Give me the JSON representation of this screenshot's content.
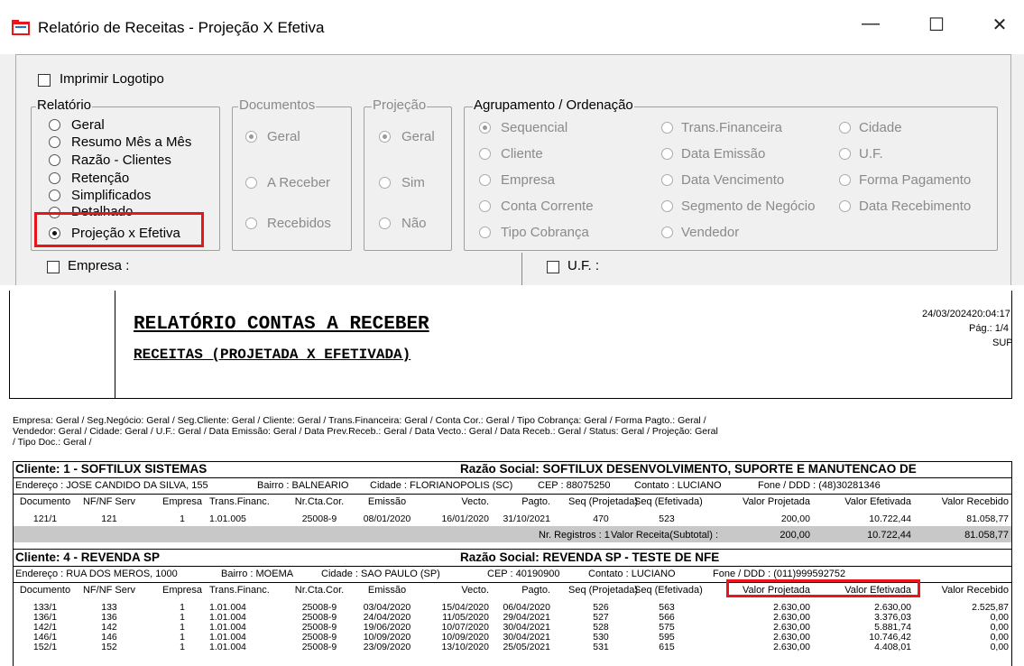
{
  "window": {
    "title": "Relatório de Receitas - Projeção X Efetiva",
    "minimize": "—",
    "maximize": "☐",
    "close": "✕"
  },
  "form": {
    "print_logo": "Imprimir Logotipo",
    "relatorio": {
      "legend": "Relatório",
      "options": [
        "Geral",
        "Resumo Mês a Mês",
        "Razão - Clientes",
        "Retenção",
        "Simplificados",
        "Detalhado",
        "Projeção x Efetiva"
      ],
      "selected": "Projeção x Efetiva"
    },
    "documentos": {
      "legend": "Documentos",
      "options": [
        "Geral",
        "A Receber",
        "Recebidos"
      ]
    },
    "projecao": {
      "legend": "Projeção",
      "options": [
        "Geral",
        "Sim",
        "Não"
      ]
    },
    "agrupamento": {
      "legend": "Agrupamento / Ordenação",
      "col1": [
        "Sequencial",
        "Cliente",
        "Empresa",
        "Conta Corrente",
        "Tipo Cobrança"
      ],
      "col2": [
        "Trans.Financeira",
        "Data Emissão",
        "Data Vencimento",
        "Segmento de Negócio",
        "Vendedor"
      ],
      "col3": [
        "Cidade",
        "U.F.",
        "Forma Pagamento",
        "Data Recebimento"
      ]
    },
    "empresa": "Empresa :",
    "uf": "U.F. :"
  },
  "report": {
    "title": "RELATÓRIO CONTAS A RECEBER",
    "subtitle": "RECEITAS (PROJETADA X EFETIVADA)",
    "date": "24/03/2024",
    "time": "20:04:17",
    "page": "Pág.: 1/4",
    "user": "SUP",
    "filters_line1": "Empresa: Geral   /   Seg.Negócio: Geral   /   Seg.Cliente: Geral   /   Cliente: Geral   / Trans.Financeira: Geral   /   Conta Cor.: Geral   /   Tipo Cobrança: Geral   /   Forma Pagto.: Geral   /",
    "filters_line2": "Vendedor: Geral   /   Cidade: Geral   /   U.F.: Geral   /   Data Emissão: Geral   /   Data Prev.Receb.: Geral   /   Data Vecto.: Geral   /   Data Receb.: Geral   /   Status: Geral   /   Projeção: Geral",
    "filters_line3": "/   Tipo Doc.: Geral   /",
    "columns": [
      "Documento",
      "NF/NF Serv",
      "Empresa",
      "Trans.Financ.",
      "Nr.Cta.Cor.",
      "Emissão",
      "Vecto.",
      "Pagto.",
      "Seq (Projetada)",
      "Seq (Efetivada)",
      "Valor Projetada",
      "Valor Efetivada",
      "Valor Recebido"
    ],
    "client1": {
      "header": "Cliente: 1  -  SOFTILUX SISTEMAS",
      "razao": "Razão Social: SOFTILUX DESENVOLVIMENTO, SUPORTE E MANUTENCAO DE",
      "endereco": "Endereço : JOSE CANDIDO DA SILVA, 155",
      "bairro": "Bairro : BALNEARIO",
      "cidade": "Cidade : FLORIANOPOLIS (SC)",
      "cep": "CEP : 88075250",
      "contato": "Contato : LUCIANO",
      "fone": "Fone / DDD : (48)30281346",
      "rows": [
        [
          "121/1",
          "121",
          "1",
          "1.01.005",
          "25008-9",
          "08/01/2020",
          "16/01/2020",
          "31/10/2021",
          "470",
          "523",
          "200,00",
          "10.722,44",
          "81.058,77"
        ]
      ],
      "nregistros": "Nr. Registros :  1",
      "subtotal_label": "Valor Receita(Subtotal) :",
      "subtotal": [
        "200,00",
        "10.722,44",
        "81.058,77"
      ]
    },
    "client2": {
      "header": "Cliente: 4  -  REVENDA SP",
      "razao": "Razão Social: REVENDA SP - TESTE DE NFE",
      "endereco": "Endereço : RUA DOS MEROS, 1000",
      "bairro": "Bairro : MOEMA",
      "cidade": "Cidade : SAO PAULO (SP)",
      "cep": "CEP : 40190900",
      "contato": "Contato : LUCIANO",
      "fone": "Fone / DDD : (011)999592752",
      "rows": [
        [
          "133/1",
          "133",
          "1",
          "1.01.004",
          "25008-9",
          "03/04/2020",
          "15/04/2020",
          "06/04/2020",
          "526",
          "563",
          "2.630,00",
          "2.630,00",
          "2.525,87"
        ],
        [
          "136/1",
          "136",
          "1",
          "1.01.004",
          "25008-9",
          "24/04/2020",
          "11/05/2020",
          "29/04/2021",
          "527",
          "566",
          "2.630,00",
          "3.376,03",
          "0,00"
        ],
        [
          "142/1",
          "142",
          "1",
          "1.01.004",
          "25008-9",
          "19/06/2020",
          "10/07/2020",
          "30/04/2021",
          "528",
          "575",
          "2.630,00",
          "5.881,74",
          "0,00"
        ],
        [
          "146/1",
          "146",
          "1",
          "1.01.004",
          "25008-9",
          "10/09/2020",
          "10/09/2020",
          "30/04/2021",
          "530",
          "595",
          "2.630,00",
          "10.746,42",
          "0,00"
        ],
        [
          "152/1",
          "152",
          "1",
          "1.01.004",
          "25008-9",
          "23/09/2020",
          "13/10/2020",
          "25/05/2021",
          "531",
          "615",
          "2.630,00",
          "4.408,01",
          "0,00"
        ]
      ]
    }
  },
  "colors": {
    "highlight": "#e8161b",
    "subtotal_bg": "#c8c8c8"
  }
}
